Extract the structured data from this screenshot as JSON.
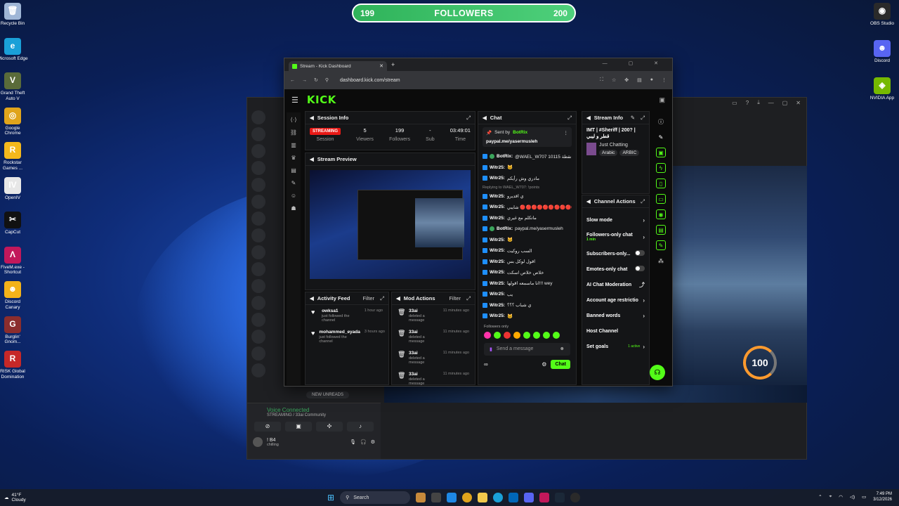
{
  "followers_bar": {
    "left": "199",
    "label": "FOLLOWERS",
    "right": "200"
  },
  "desktop_left": [
    {
      "label": "Recycle Bin",
      "icon": "recycle-bin-icon",
      "color": "#9fb6d6",
      "glyph": "🗑"
    },
    {
      "label": "Microsoft Edge",
      "icon": "edge-icon",
      "color": "#1aa0d8",
      "glyph": "e"
    },
    {
      "label": "Grand Theft Auto V",
      "icon": "gta-icon",
      "color": "#5a6b3a",
      "glyph": "V"
    },
    {
      "label": "Google Chrome",
      "icon": "chrome-icon",
      "color": "#e0a41c",
      "glyph": "◎"
    },
    {
      "label": "Rockstar Games ...",
      "icon": "rockstar-icon",
      "color": "#f4b81c",
      "glyph": "R"
    },
    {
      "label": "OpenIV",
      "icon": "openiv-icon",
      "color": "#e7e7e7",
      "glyph": "IV"
    },
    {
      "label": "CapCut",
      "icon": "capcut-icon",
      "color": "#111111",
      "glyph": "✂"
    },
    {
      "label": "FiveM.exe - Shortcut",
      "icon": "fivem-icon",
      "color": "#c2185b",
      "glyph": "Λ"
    },
    {
      "label": "Discord Canary",
      "icon": "discord-canary-icon",
      "color": "#f3b21a",
      "glyph": "☻"
    },
    {
      "label": "Burglin' Gnom...",
      "icon": "burglin-gnomes-icon",
      "color": "#8b2d2d",
      "glyph": "G"
    },
    {
      "label": "RISK Global Domination",
      "icon": "risk-icon",
      "color": "#c62828",
      "glyph": "R"
    }
  ],
  "desktop_right": [
    {
      "label": "OBS Studio",
      "icon": "obs-icon",
      "color": "#2a2a2a",
      "glyph": "◉"
    },
    {
      "label": "Discord",
      "icon": "discord-icon",
      "color": "#5865f2",
      "glyph": "☻"
    },
    {
      "label": "NVIDIA App",
      "icon": "nvidia-icon",
      "color": "#76b900",
      "glyph": "◈"
    }
  ],
  "browser": {
    "tab_title": "Stream - Kick Dashboard",
    "url": "dashboard.kick.com/stream"
  },
  "kick": {
    "logo": "KICK"
  },
  "session": {
    "title": "Session Info",
    "status": "STREAMING",
    "status_label": "Session",
    "viewers": "5",
    "viewers_label": "Viewers",
    "followers": "199",
    "followers_label": "Followers",
    "subs": "-",
    "subs_label": "Sub",
    "time": "03:49:01",
    "time_label": "Time"
  },
  "preview": {
    "title": "Stream Preview"
  },
  "activity": {
    "title": "Activity Feed",
    "filter": "Filter",
    "items": [
      {
        "name": "owksa1",
        "sub": "just followed the channel",
        "time": "1 hour ago"
      },
      {
        "name": "mohammed_eyada",
        "sub": "just followed the channel",
        "time": "3 hours ago"
      }
    ]
  },
  "mod": {
    "title": "Mod Actions",
    "filter": "Filter",
    "items": [
      {
        "name": "33ai",
        "sub": "deleted a message",
        "time": "11 minutes ago"
      },
      {
        "name": "33ai",
        "sub": "deleted a message",
        "time": "11 minutes ago"
      },
      {
        "name": "33ai",
        "sub": "deleted a message",
        "time": "11 minutes ago"
      },
      {
        "name": "33ai",
        "sub": "deleted a message",
        "time": "11 minutes ago"
      }
    ]
  },
  "chat": {
    "title": "Chat",
    "pinned_by": "Sent by",
    "pinned_user": "BotRix",
    "pinned_text": "paypal.me/yasermusleh",
    "messages": [
      {
        "u": "BotRix:",
        "t": "@WAEL_W707 10115 لديك نقطة",
        "g": true
      },
      {
        "u": "Witr25:",
        "t": "🐱"
      },
      {
        "u": "Witr25:",
        "t": "مادري وش رأيكم"
      },
      {
        "reply": "Replying to WAEL_W707: !points"
      },
      {
        "u": "Witr25:",
        "t": "ي اقديرو"
      },
      {
        "u": "Witr25:",
        "t": "شايبي 🔴🔴🔴🔴🔴🔴🔴🔴🔴🔴🔴🔴🔴🔴🔴"
      },
      {
        "u": "Witr25:",
        "t": "ماتكلم مع غيري"
      },
      {
        "u": "BotRix:",
        "t": "paypal.me/yasermusleh",
        "g": true
      },
      {
        "u": "Witr25:",
        "t": "🐱"
      },
      {
        "u": "Witr25:",
        "t": "السب روكيت"
      },
      {
        "u": "Witr25:",
        "t": "اقول لوكل بس"
      },
      {
        "u": "Witr25:",
        "t": "خلاص خلاص اسكت"
      },
      {
        "u": "Witr25:",
        "t": "انا ماسمعه اقولها!!! wey"
      },
      {
        "u": "Witr25:",
        "t": "يب"
      },
      {
        "u": "Witr25:",
        "t": "ي شباب ؟؟؟"
      },
      {
        "u": "Witr25:",
        "t": "🐱"
      }
    ],
    "followers_only": "Followers only",
    "placeholder": "Send a message",
    "send_label": "Chat",
    "loop": "∞"
  },
  "stream_info": {
    "title": "Stream Info",
    "name": "IMT | #Sheriff | 200? | قطر و ليبي",
    "category": "Just Chatting",
    "tags": [
      "Arabic",
      "ARBIC"
    ]
  },
  "channel_actions": {
    "title": "Channel Actions",
    "slow_mode": "Slow mode",
    "followers_only": "Followers-only chat",
    "followers_only_sub": "1 min",
    "subscribers_only": "Subscribers-only...",
    "emotes_only": "Emotes-only chat",
    "ai_mod": "AI Chat Moderation",
    "age_restrict": "Account age restrictio",
    "banned_words": "Banned words",
    "host": "Host Channel",
    "set_goals": "Set goals",
    "goals_status": "1 active"
  },
  "discord": {
    "voice_connected": "Voice Connected",
    "voice_sub": "STREAMING / 33ai Community",
    "user": "! B4",
    "user_status": "chilling",
    "new_unreads": "NEW UNREADS",
    "new_badge": "NEW"
  },
  "game": {
    "boost": "100"
  },
  "taskbar": {
    "temp": "41°F",
    "weather": "Cloudy",
    "search": "Search",
    "time": "7:49 PM",
    "date": "3/12/2026"
  }
}
